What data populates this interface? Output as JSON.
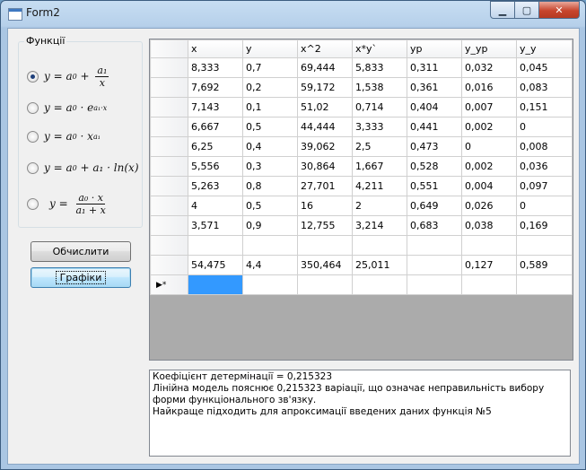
{
  "window": {
    "title": "Form2",
    "minimize_glyph": "▁",
    "maximize_glyph": "▢",
    "close_glyph": "✕"
  },
  "functions_group": {
    "legend": "Функції",
    "selected_index": 0,
    "options": [
      {
        "lhs": "y = a",
        "sub0": "0",
        "tail": " + ",
        "num": "a₁",
        "den": "x"
      },
      {
        "lhs": "y = a",
        "sub0": "0",
        "tail": " · e",
        "sup": "a₁·x"
      },
      {
        "lhs": "y = a",
        "sub0": "0",
        "tail": " · x",
        "sup": "a₁"
      },
      {
        "lhs": "y = a",
        "sub0": "0",
        "tail": " + a₁ · ln(x)"
      },
      {
        "lhs": "y = ",
        "num": "a₀ · x",
        "den": "a₁ + x"
      }
    ]
  },
  "buttons": {
    "calculate": "Обчислити",
    "charts": "Графіки"
  },
  "grid": {
    "columns": [
      "x",
      "y",
      "x^2",
      "x*y`",
      "yp",
      "y_yp",
      "y_y"
    ],
    "rows": [
      [
        "8,333",
        "0,7",
        "69,444",
        "5,833",
        "0,311",
        "0,032",
        "0,045"
      ],
      [
        "7,692",
        "0,2",
        "59,172",
        "1,538",
        "0,361",
        "0,016",
        "0,083"
      ],
      [
        "7,143",
        "0,1",
        "51,02",
        "0,714",
        "0,404",
        "0,007",
        "0,151"
      ],
      [
        "6,667",
        "0,5",
        "44,444",
        "3,333",
        "0,441",
        "0,002",
        "0"
      ],
      [
        "6,25",
        "0,4",
        "39,062",
        "2,5",
        "0,473",
        "0",
        "0,008"
      ],
      [
        "5,556",
        "0,3",
        "30,864",
        "1,667",
        "0,528",
        "0,002",
        "0,036"
      ],
      [
        "5,263",
        "0,8",
        "27,701",
        "4,211",
        "0,551",
        "0,004",
        "0,097"
      ],
      [
        "4",
        "0,5",
        "16",
        "2",
        "0,649",
        "0,026",
        "0"
      ],
      [
        "3,571",
        "0,9",
        "12,755",
        "3,214",
        "0,683",
        "0,038",
        "0,169"
      ],
      [
        "",
        "",
        "",
        "",
        "",
        "",
        ""
      ],
      [
        "54,475",
        "4,4",
        "350,464",
        "25,011",
        "",
        "0,127",
        "0,589"
      ]
    ],
    "new_row_indicator": "▶*"
  },
  "output": {
    "lines": [
      "Коефіцієнт детермінації = 0,215323",
      "Лінійна модель пояснює 0,215323 варіації, що  означає неправильність вибору форми функціонального зв'язку.",
      "Найкраще підходить для апроксимації введених даних функція №5"
    ]
  }
}
